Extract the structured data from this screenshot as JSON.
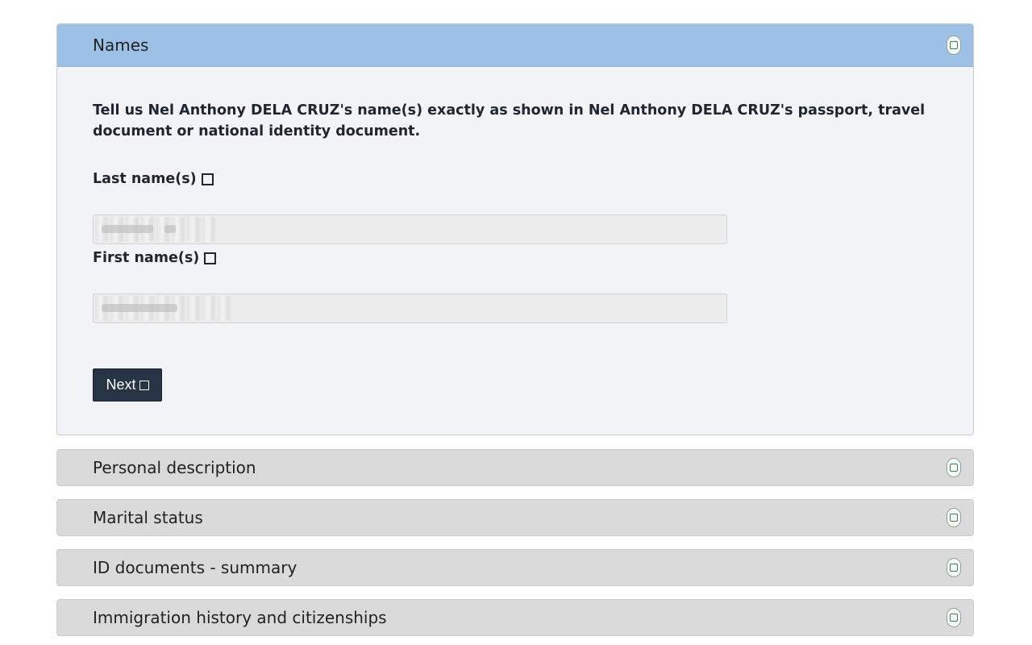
{
  "sections": {
    "names": {
      "title": "Names",
      "intro": "Tell us Nel Anthony DELA CRUZ's name(s) exactly as shown in Nel Anthony DELA CRUZ's passport, travel document or national identity document.",
      "last_name_label": "Last name(s)",
      "last_name_value": "",
      "first_name_label": "First name(s)",
      "first_name_value": "",
      "next_label": "Next"
    },
    "collapsed": [
      {
        "title": "Personal description"
      },
      {
        "title": "Marital status"
      },
      {
        "title": "ID documents - summary"
      },
      {
        "title": "Immigration history and citizenships"
      }
    ]
  },
  "icons": {
    "status": "status-check-icon",
    "label_marker": "square-icon"
  },
  "colors": {
    "header_active": "#9dc1e6",
    "header_collapsed": "#dadada",
    "button": "#263445",
    "status_green": "#2d8a3e"
  }
}
